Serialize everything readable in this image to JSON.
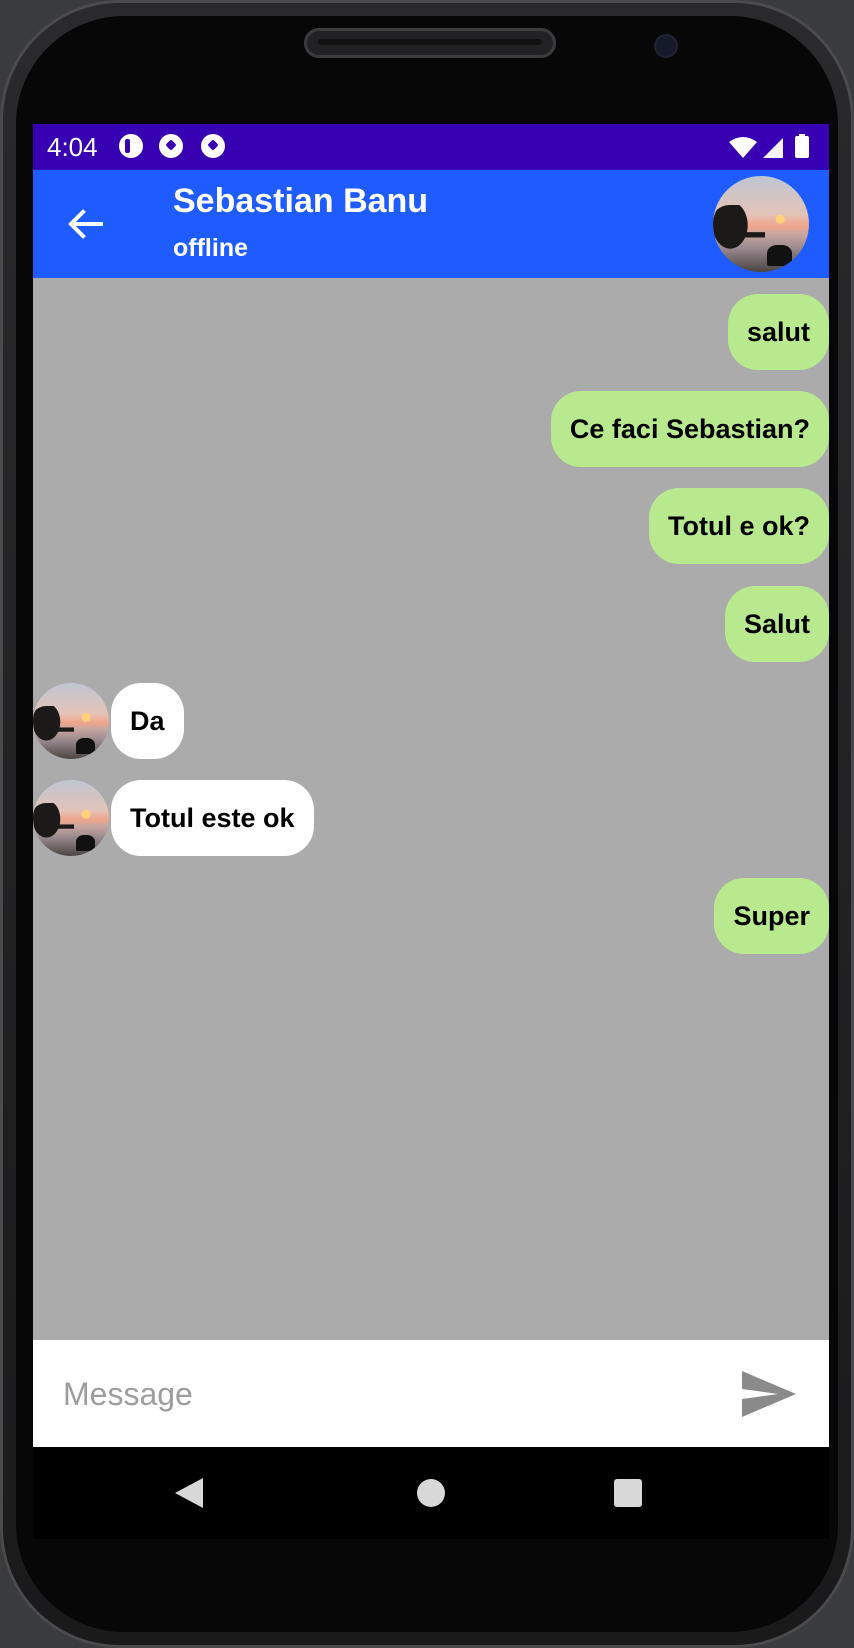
{
  "status_bar": {
    "time": "4:04",
    "icons": [
      "app-icon",
      "soccer-icon",
      "soccer-icon",
      "wifi-icon",
      "signal-icon",
      "battery-icon"
    ]
  },
  "header": {
    "contact_name": "Sebastian Banu",
    "contact_status": "offline",
    "back_icon": "arrow-left-icon",
    "avatar": "contact-avatar"
  },
  "messages": [
    {
      "direction": "out",
      "text": "salut"
    },
    {
      "direction": "out",
      "text": "Ce faci Sebastian?"
    },
    {
      "direction": "out",
      "text": "Totul e ok?"
    },
    {
      "direction": "out",
      "text": "Salut"
    },
    {
      "direction": "in",
      "text": "Da"
    },
    {
      "direction": "in",
      "text": "Totul este ok"
    },
    {
      "direction": "out",
      "text": "Super"
    }
  ],
  "composer": {
    "placeholder": "Message",
    "value": "",
    "send_icon": "send-icon"
  },
  "navigation": {
    "back": "nav-back-icon",
    "home": "nav-home-icon",
    "recents": "nav-recents-icon"
  },
  "colors": {
    "status_bar": "#3700b3",
    "app_bar": "#1e5cff",
    "chat_background": "#ababab",
    "outgoing_bubble": "#b9e98f",
    "incoming_bubble": "#ffffff"
  }
}
